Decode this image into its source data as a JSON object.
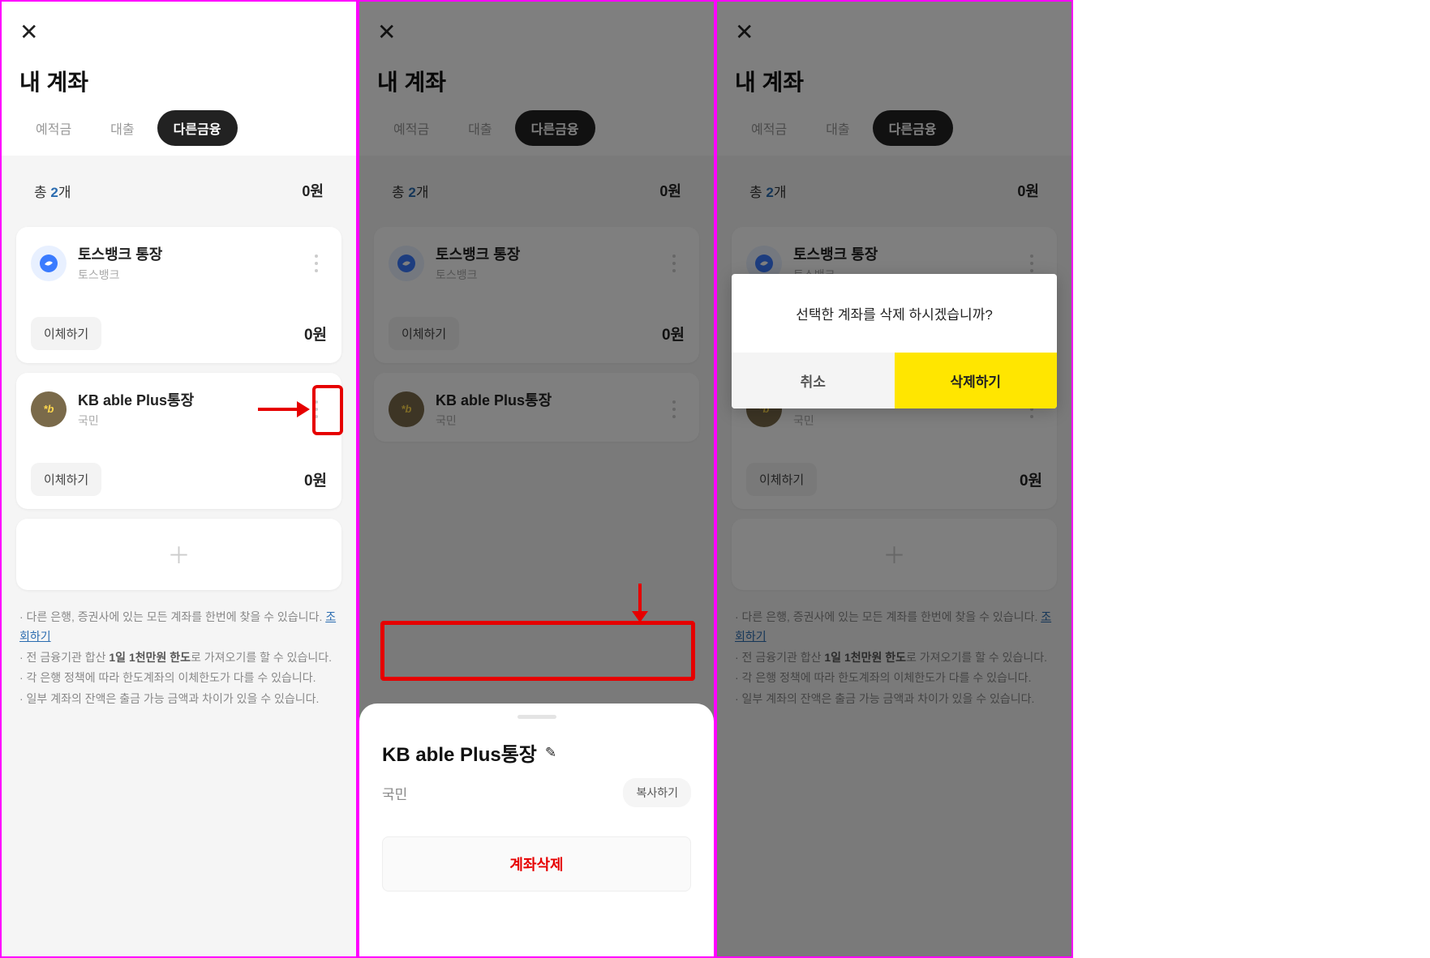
{
  "page_title": "내 계좌",
  "tabs": {
    "t1": "예적금",
    "t2": "대출",
    "t3": "다른금융"
  },
  "summary": {
    "prefix": "총 ",
    "count": "2",
    "suffix": "개",
    "amount": "0원"
  },
  "accounts": [
    {
      "name": "토스뱅크 통장",
      "bank": "토스뱅크",
      "transfer": "이체하기",
      "balance": "0원"
    },
    {
      "name": "KB able Plus통장",
      "bank": "국민",
      "transfer": "이체하기",
      "balance": "0원"
    }
  ],
  "footer": {
    "note1a": "· 다른 은행, 증권사에 있는 모든 계좌를 한번에 찾을 수 있습니다. ",
    "note1_link": "조회하기",
    "note2a": "· 전 금융기관 합산 ",
    "note2_bold": "1일 1천만원 한도",
    "note2b": "로 가져오기를 할 수 있습니다.",
    "note3": "· 각 은행 정책에 따라 한도계좌의 이체한도가 다를 수 있습니다.",
    "note4": "· 일부 계좌의 잔액은 출금 가능 금액과 차이가 있을 수 있습니다."
  },
  "sheet": {
    "title": "KB able Plus통장",
    "bank": "국민",
    "copy": "복사하기",
    "delete": "계좌삭제"
  },
  "dialog": {
    "text": "선택한 계좌를 삭제 하시겠습니까?",
    "cancel": "취소",
    "confirm": "삭제하기"
  }
}
